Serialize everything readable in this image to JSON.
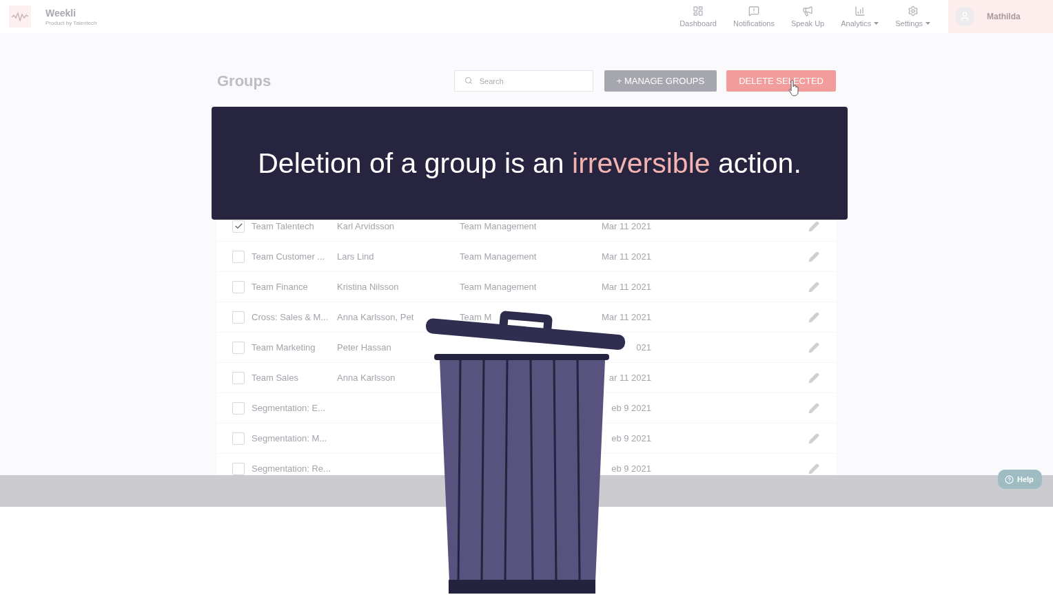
{
  "header": {
    "brand": "Weekli",
    "tagline": "Product by Talentech",
    "nav": [
      {
        "label": "Dashboard",
        "dropdown": false
      },
      {
        "label": "Notifications",
        "dropdown": false
      },
      {
        "label": "Speak Up",
        "dropdown": false
      },
      {
        "label": "Analytics",
        "dropdown": true
      },
      {
        "label": "Settings",
        "dropdown": true
      }
    ],
    "user": {
      "name": "Mathilda"
    }
  },
  "page": {
    "title": "Groups",
    "search": {
      "placeholder": "Search"
    },
    "buttons": [
      {
        "label": "+ MANAGE GROUPS",
        "kind": "secondary"
      },
      {
        "label": "DELETE SELECTED",
        "kind": "danger"
      }
    ]
  },
  "caption": {
    "parts": [
      {
        "text": "Deletion of a group is an ",
        "emphasis": false
      },
      {
        "text": "irreversible",
        "emphasis": true
      },
      {
        "text": " action.",
        "emphasis": false
      }
    ]
  },
  "rows": [
    {
      "checked": true,
      "name": "Team Talentech",
      "owner": "Karl Arvidsson",
      "type": "Team Management",
      "date": "Mar 11 2021"
    },
    {
      "checked": false,
      "name": "Team Customer ...",
      "owner": "Lars Lind",
      "type": "Team Management",
      "date": "Mar 11 2021"
    },
    {
      "checked": false,
      "name": "Team Finance",
      "owner": "Kristina Nilsson",
      "type": "Team Management",
      "date": "Mar 11 2021"
    },
    {
      "checked": false,
      "name": "Cross: Sales & M...",
      "owner": "Anna Karlsson, Pet",
      "type": "Team M",
      "date": "Mar 11 2021"
    },
    {
      "checked": false,
      "name": "Team Marketing",
      "owner": "Peter Hassan",
      "date": "021"
    },
    {
      "checked": false,
      "name": "Team Sales",
      "owner": "Anna Karlsson",
      "date": "ar 11 2021"
    },
    {
      "checked": false,
      "name": "Segmentation: E...",
      "date": "eb 9 2021"
    },
    {
      "checked": false,
      "name": "Segmentation: M...",
      "date": "eb 9 2021"
    },
    {
      "checked": false,
      "name": "Segmentation: Re...",
      "date": "eb 9 2021"
    }
  ],
  "help": {
    "label": "Help"
  }
}
